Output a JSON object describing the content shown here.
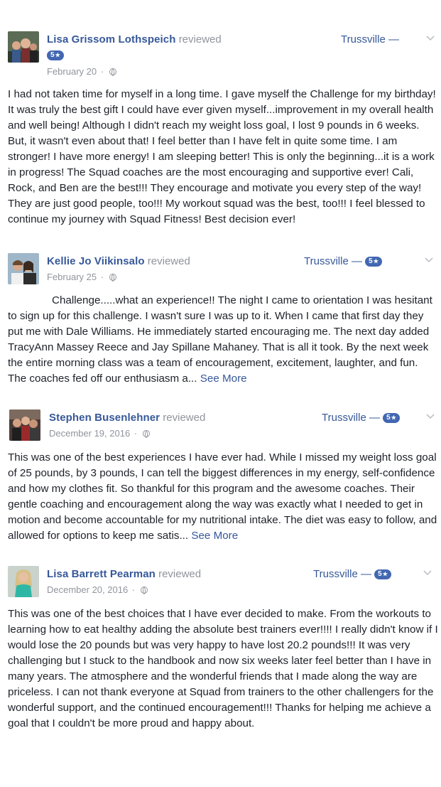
{
  "reviews": [
    {
      "name": "Lisa Grissom Lothspeich",
      "action": "reviewed",
      "location": "Trussville —",
      "rating": "5",
      "date": "February 20",
      "text": "I had not taken time for myself in a long time. I gave myself the                    Challenge for my birthday! It was truly the best gift I could have ever given myself...improvement in my overall health and well being! Although I didn't reach my weight loss goal, I lost 9 pounds in 6 weeks. But, it wasn't even about that! I feel better than I have felt in quite some time. I am stronger! I have more energy! I am sleeping better! This is only the beginning...it is a work in progress! The Squad coaches are the most encouraging and supportive ever! Cali, Rock, and Ben are the best!!! They encourage and motivate you every step of the way! They are just good people, too!!! My workout squad was the best, too!!! I feel blessed to continue my journey with Squad Fitness! Best decision ever!",
      "see_more": ""
    },
    {
      "name": "Kellie Jo Viikinsalo",
      "action": "reviewed",
      "location": "Trussville —",
      "rating": "5",
      "date": "February 25",
      "text": "Challenge.....what an experience!! The night I came to orientation I was hesitant to sign up for this challenge. I wasn't sure I was up to it. When I came that first day they put me with Dale Williams. He immediately started encouraging me. The next day added TracyAnn Massey Reece and Jay Spillane Mahaney. That is all it took. By the next week the entire morning class was a team of encouragement, excitement, laughter, and fun. The coaches fed off our enthusiasm a...",
      "see_more": "See More"
    },
    {
      "name": "Stephen Busenlehner",
      "action": "reviewed",
      "location": "Trussville —",
      "rating": "5",
      "date": "December 19, 2016",
      "text": "This was one of the best experiences I have ever had. While I missed my weight loss goal of 25 pounds, by 3 pounds, I can tell the biggest differences in my energy, self-confidence and how my clothes fit. So thankful for this program and the awesome coaches. Their gentle coaching and encouragement along the way was exactly what I needed to get in motion and become accountable for my nutritional intake. The diet was easy to follow, and allowed for options to keep me satis...",
      "see_more": "See More"
    },
    {
      "name": "Lisa Barrett Pearman",
      "action": "reviewed",
      "location": "Trussville —",
      "rating": "5",
      "date": "December 20, 2016",
      "text": "This was one of the best choices that I have ever decided to make. From the workouts to learning how to eat healthy adding the absolute best trainers ever!!!! I really didn't know if I would lose the 20 pounds but was very happy to have lost 20.2 pounds!!! It was very challenging but I stuck to the handbook and now six weeks later feel better than I have in many years. The atmosphere and the wonderful friends that I made along the way are priceless. I can not thank everyone at Squad from trainers to the other challengers for the wonderful support, and the continued encouragement!!! Thanks for helping me achieve a goal that I couldn't be more proud and happy about.",
      "see_more": ""
    }
  ],
  "icons": {
    "privacy": "globe-icon",
    "options": "chevron-down-icon",
    "rating_star": "★"
  },
  "colors": {
    "link": "#365899",
    "meta": "#90949c",
    "badge": "#4267b2",
    "text": "#1d2129"
  }
}
